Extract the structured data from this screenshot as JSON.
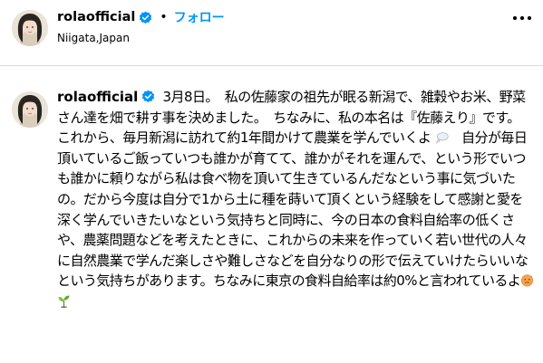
{
  "header": {
    "username": "rolaofficial",
    "separator": "•",
    "follow_label": "フォロー",
    "location": "Niigata,Japan"
  },
  "comment": {
    "username": "rolaofficial",
    "line1": "3月8日。　私の佐藤家の祖先が眠る新潟で、雑穀やお米、野菜さん達を畑で耕す事を決めました。　ちなみに、私の本名は『佐藤えり』です。　これから、毎月新潟に訪れて約1年間かけて農業を学んでいくよ",
    "line2": "　自分が毎日頂いているご飯っていつも誰かが育てて、誰かがそれを運んで、という形でいつも誰かに頼りながら私は食べ物を頂いて生きているんだなという事に気づいたの。だから今度は自分で1から土に種を蒔いて頂くという経験をして感謝と愛を深く学んでいきたいなという気持ちと同時に、今の日本の食料自給率の低くさや、農薬問題などを考えたときに、これからの未来を作っていく若い世代の人々に自然農業で学んだ楽しさや難しさなどを自分なりの形で伝えていけたらいいなという気持ちがあります。ちなみに東京の食料自給率は約0%と言われているよ",
    "emojis": [
      "thought-balloon-emoji",
      "sweating-face-emoji",
      "seedling-emoji"
    ]
  },
  "colors": {
    "accent": "#0095f6",
    "verified": "#0095f6",
    "divider": "#dbdbdb"
  }
}
